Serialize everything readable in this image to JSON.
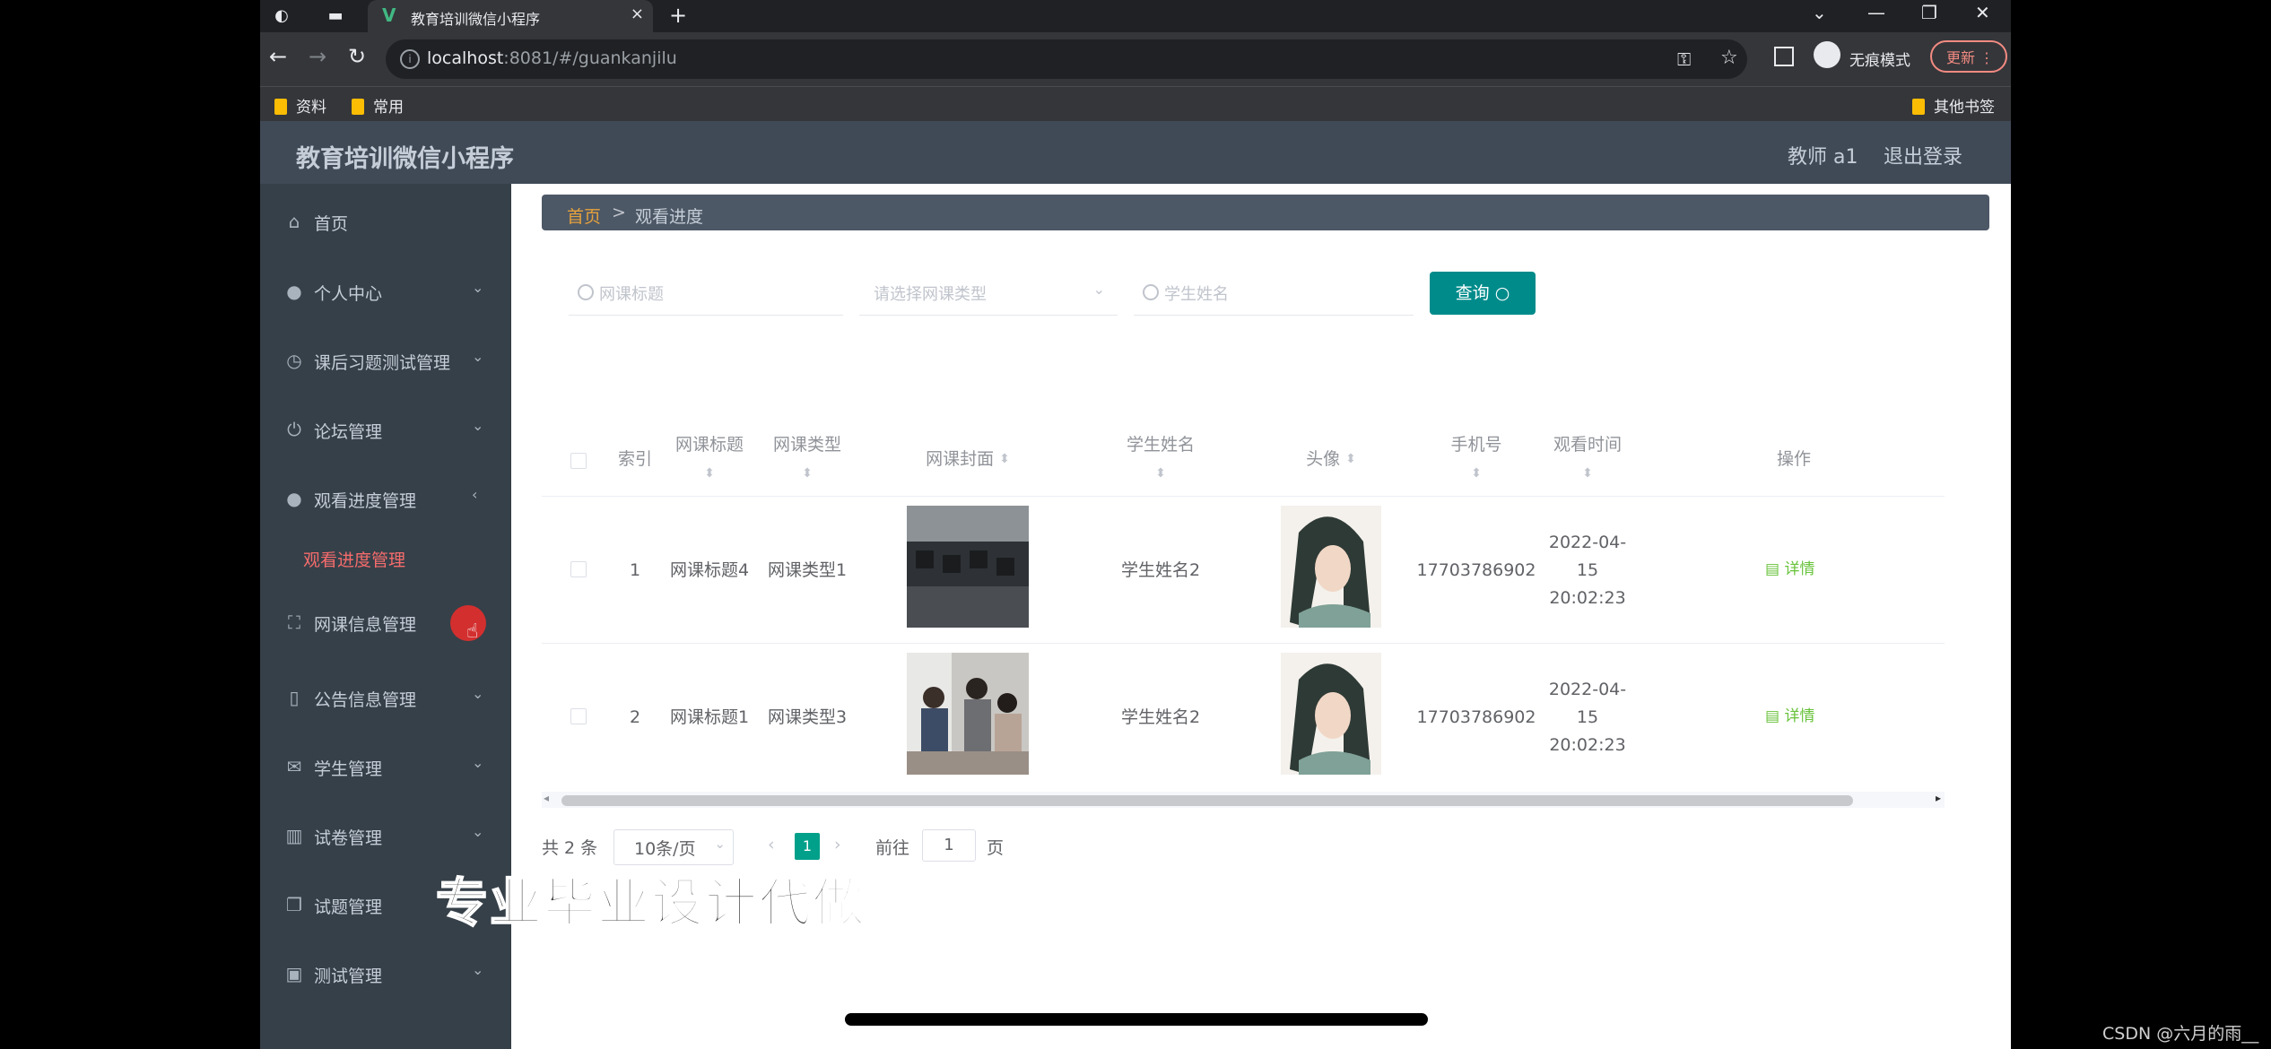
{
  "browser": {
    "tab_title": "教育培训微信小程序",
    "url_host": "localhost",
    "url_rest": ":8081/#/guankanjilu",
    "incognito_label": "无痕模式",
    "update_label": "更新",
    "bookmarks": [
      "资料",
      "常用"
    ],
    "other_bookmarks": "其他书签"
  },
  "app": {
    "title": "教育培训微信小程序",
    "user": "教师 a1",
    "logout": "退出登录"
  },
  "sidebar": {
    "items": [
      {
        "label": "首页",
        "icon": "home-icon"
      },
      {
        "label": "个人中心",
        "icon": "user-icon"
      },
      {
        "label": "课后习题测试管理",
        "icon": "clock-icon"
      },
      {
        "label": "论坛管理",
        "icon": "power-icon"
      },
      {
        "label": "观看进度管理",
        "icon": "user-icon"
      },
      {
        "label": "网课信息管理",
        "icon": "fullscreen-icon"
      },
      {
        "label": "公告信息管理",
        "icon": "phone-icon"
      },
      {
        "label": "学生管理",
        "icon": "mail-icon"
      },
      {
        "label": "试卷管理",
        "icon": "chart-icon"
      },
      {
        "label": "试题管理",
        "icon": "copy-icon"
      },
      {
        "label": "测试管理",
        "icon": "trash-icon"
      }
    ],
    "active_sub": "观看进度管理"
  },
  "breadcrumb": {
    "home": "首页",
    "sep": ">",
    "current": "观看进度"
  },
  "search": {
    "title_placeholder": "网课标题",
    "type_placeholder": "请选择网课类型",
    "student_placeholder": "学生姓名",
    "query_label": "查询"
  },
  "table": {
    "headers": [
      "索引",
      "网课标题",
      "网课类型",
      "网课封面",
      "学生姓名",
      "头像",
      "手机号",
      "观看时间",
      "操作"
    ],
    "rows": [
      {
        "index": "1",
        "title": "网课标题4",
        "type": "网课类型1",
        "student": "学生姓名2",
        "phone": "17703786902",
        "time": "2022-04-15 20:02:23",
        "action": "详情"
      },
      {
        "index": "2",
        "title": "网课标题1",
        "type": "网课类型3",
        "student": "学生姓名2",
        "phone": "17703786902",
        "time": "2022-04-15 20:02:23",
        "action": "详情"
      }
    ]
  },
  "pagination": {
    "total": "共 2 条",
    "page_size": "10条/页",
    "current_page": "1",
    "goto_label": "前往",
    "goto_value": "1",
    "page_suffix": "页"
  },
  "overlay": {
    "watermark": "专业毕业设计代做",
    "credit": "CSDN @六月的雨__"
  }
}
